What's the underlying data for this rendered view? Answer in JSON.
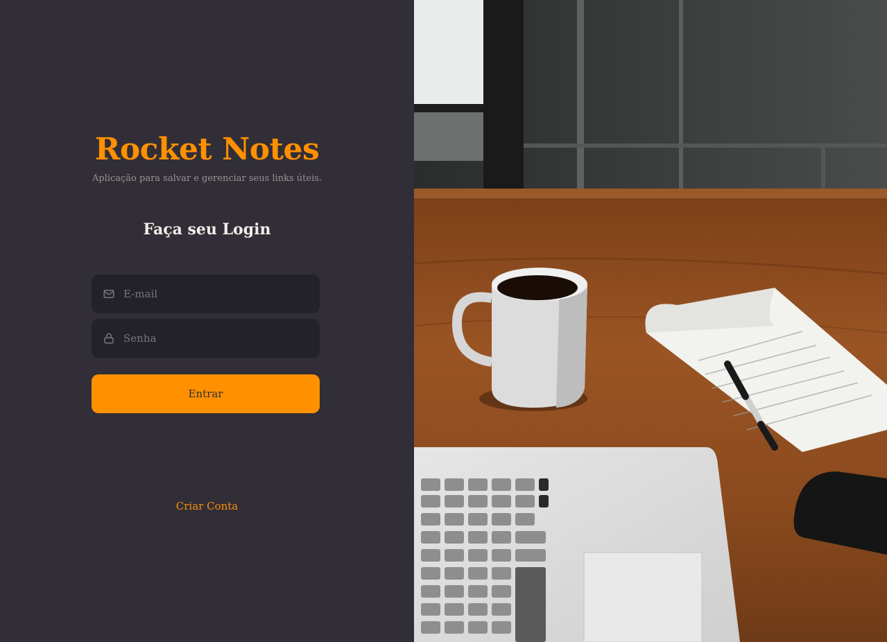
{
  "brand": {
    "title": "Rocket Notes",
    "subtitle": "Aplicação para salvar e gerenciar seus links úteis."
  },
  "login": {
    "heading": "Faça seu Login",
    "email": {
      "placeholder": "E-mail",
      "icon": "mail-icon"
    },
    "password": {
      "placeholder": "Senha",
      "icon": "lock-icon"
    },
    "submit_label": "Entrar",
    "create_account_label": "Criar Conta"
  },
  "colors": {
    "background": "#312e38",
    "input_background": "#232129",
    "accent": "#ff9000",
    "text": "#f4ede8",
    "muted": "#999591"
  }
}
